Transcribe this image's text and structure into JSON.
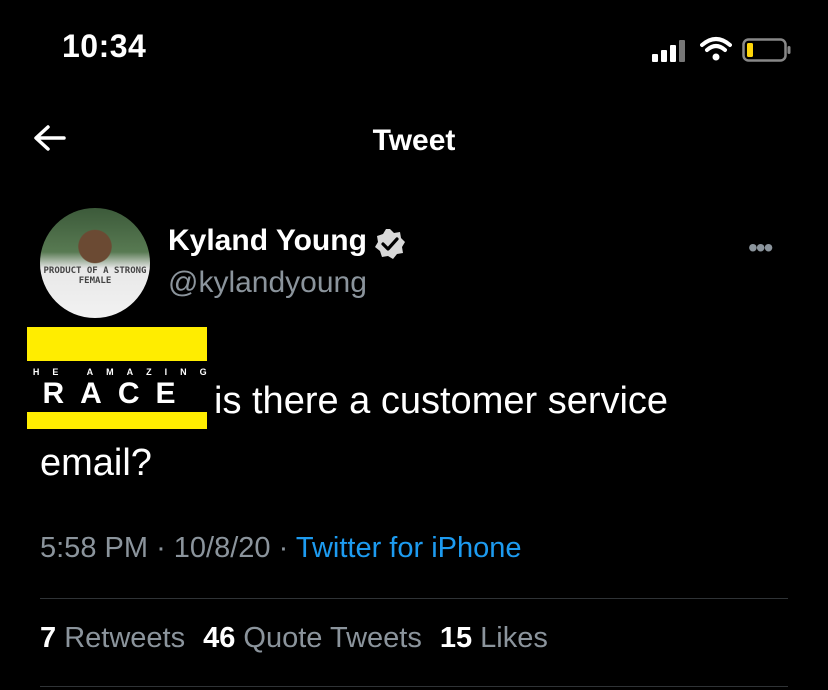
{
  "status_bar": {
    "time": "10:34",
    "icons": [
      "cellular-signal-icon",
      "wifi-icon",
      "battery-icon"
    ]
  },
  "nav": {
    "back_icon": "back-arrow-icon",
    "title": "Tweet"
  },
  "tweet": {
    "author": {
      "display_name": "Kyland Young",
      "handle": "@kylandyoung",
      "verified": true,
      "avatar_shirt_text": "PRODUCT OF A STRONG FEMALE"
    },
    "more_icon": "more-options-icon",
    "logo": {
      "top_text": "THE AMAZING",
      "main_text": "RACE",
      "colors": {
        "band": "#ffed00",
        "text": "#ffffff",
        "bg": "#000000"
      }
    },
    "text_after_logo": "is there a customer service",
    "text_line2": "email?",
    "time": "5:58 PM",
    "date": "10/8/20",
    "source": "Twitter for iPhone",
    "separator": "·",
    "stats": [
      {
        "count": "7",
        "label": "Retweets"
      },
      {
        "count": "46",
        "label": "Quote Tweets"
      },
      {
        "count": "15",
        "label": "Likes"
      }
    ]
  },
  "colors": {
    "background": "#000000",
    "secondary_text": "#8b949c",
    "link": "#1d9bf0",
    "divider": "#2f3336"
  }
}
